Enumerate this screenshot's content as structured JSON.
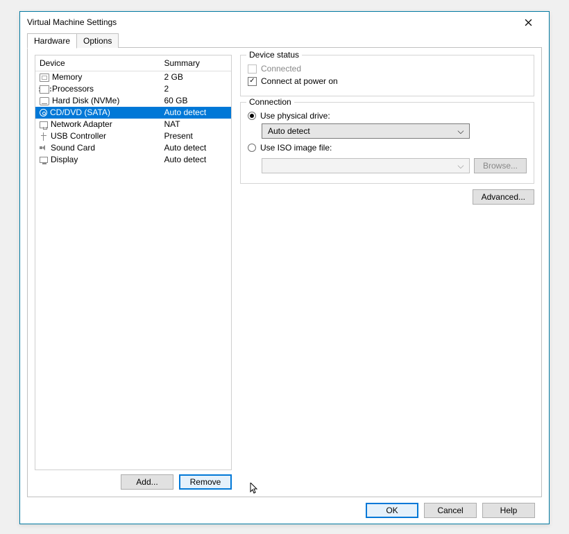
{
  "window": {
    "title": "Virtual Machine Settings"
  },
  "tabs": {
    "hardware": "Hardware",
    "options": "Options",
    "active": "hardware"
  },
  "columns": {
    "device": "Device",
    "summary": "Summary"
  },
  "devices": [
    {
      "icon": "memory",
      "name": "Memory",
      "summary": "2 GB",
      "selected": false
    },
    {
      "icon": "cpu",
      "name": "Processors",
      "summary": "2",
      "selected": false
    },
    {
      "icon": "hdd",
      "name": "Hard Disk (NVMe)",
      "summary": "60 GB",
      "selected": false
    },
    {
      "icon": "disc",
      "name": "CD/DVD (SATA)",
      "summary": "Auto detect",
      "selected": true
    },
    {
      "icon": "net",
      "name": "Network Adapter",
      "summary": "NAT",
      "selected": false
    },
    {
      "icon": "usb",
      "name": "USB Controller",
      "summary": "Present",
      "selected": false
    },
    {
      "icon": "sound",
      "name": "Sound Card",
      "summary": "Auto detect",
      "selected": false
    },
    {
      "icon": "display",
      "name": "Display",
      "summary": "Auto detect",
      "selected": false
    }
  ],
  "leftButtons": {
    "add": "Add...",
    "remove": "Remove"
  },
  "deviceStatus": {
    "legend": "Device status",
    "connected_label": "Connected",
    "connected_checked": false,
    "connected_enabled": false,
    "connect_power_label": "Connect at power on",
    "connect_power_checked": true
  },
  "connection": {
    "legend": "Connection",
    "physical_label": "Use physical drive:",
    "physical_selected": true,
    "physical_drive_value": "Auto detect",
    "iso_label": "Use ISO image file:",
    "iso_selected": false,
    "iso_path": "",
    "browse_label": "Browse..."
  },
  "advanced_label": "Advanced...",
  "footer": {
    "ok": "OK",
    "cancel": "Cancel",
    "help": "Help"
  }
}
